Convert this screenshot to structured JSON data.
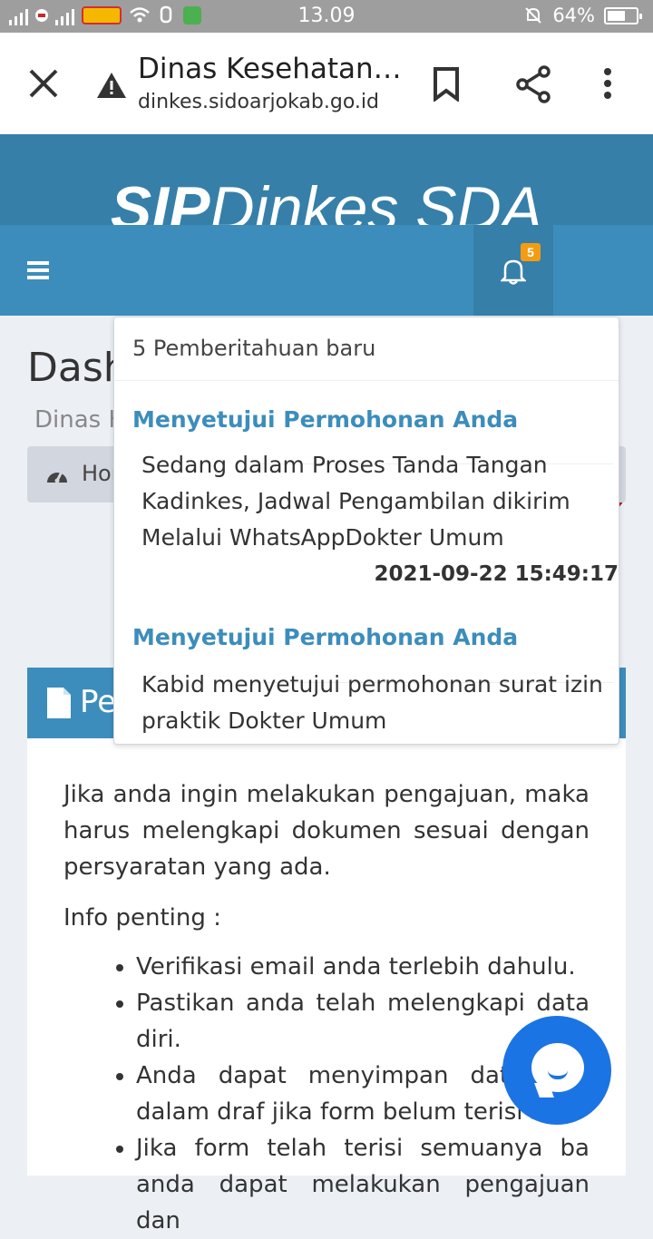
{
  "status_bar": {
    "time": "13.09",
    "battery": "64%",
    "battery_level": 0.64
  },
  "browser": {
    "title": "Dinas Kesehatan…",
    "url": "dinkes.sidoarjokab.go.id",
    "icons": [
      "close-icon",
      "warning-icon",
      "bookmark-icon",
      "share-icon",
      "more-icon"
    ]
  },
  "brand": {
    "bold": "SIP",
    "light": " Dinkes SDA",
    "color": "#367fa9"
  },
  "navbar": {
    "badge_count": "5",
    "color": "#3c8dbc",
    "badge_color": "#f39c12"
  },
  "page": {
    "title": "Dash",
    "subtitle": "Dinas K",
    "breadcrumb_home": "Hor"
  },
  "panel": {
    "title": "Pe",
    "intro": "Jika anda ingin melakukan pengajuan, maka harus melengkapi dokumen sesuai dengan persyaratan yang ada.",
    "info_label": "Info penting :",
    "items": [
      "Verifikasi email anda terlebih dahulu.",
      "Pastikan anda telah melengkapi data diri.",
      "Anda dapat menyimpan data pen dalam draf jika form belum terisi se",
      "Jika form telah terisi semuanya ba anda dapat melakukan pengajuan dan"
    ]
  },
  "notifications": {
    "header": "5 Pemberitahuan baru",
    "items": [
      {
        "title": "Menyetujui Permohonan Anda",
        "body": "Sedang dalam Proses Tanda Tangan Kadinkes, Jadwal Pengambilan dikirim Melalui WhatsAppDokter Umum",
        "date": "2021-09-22 15:49:17"
      },
      {
        "title": "Menyetujui Permohonan Anda",
        "body": "Kabid menyetujui permohonan surat izin praktik Dokter Umum",
        "date": ""
      }
    ]
  }
}
